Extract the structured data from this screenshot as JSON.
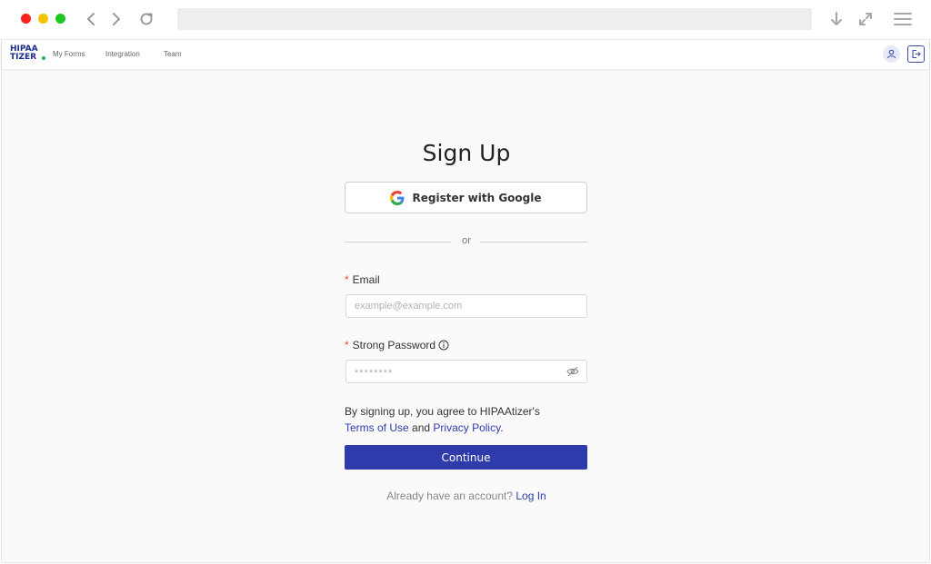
{
  "browser": {
    "controls": [
      "close",
      "minimize",
      "maximize"
    ],
    "icons": [
      "back-icon",
      "forward-icon",
      "reload-icon",
      "download-icon",
      "expand-icon",
      "menu-icon"
    ]
  },
  "app_header": {
    "logo_line1": "HIPAA",
    "logo_line2": "TIZER",
    "nav": [
      "My Forms",
      "Integration",
      "Team"
    ],
    "icons": [
      "user-icon",
      "logout-icon"
    ]
  },
  "form": {
    "title": "Sign Up",
    "google_label": "Register with Google",
    "divider_text": "or",
    "email_label": "Email",
    "email_placeholder": "example@example.com",
    "password_label": "Strong Password",
    "password_value": "********",
    "required_mark": "*",
    "terms_prefix": "By signing up, you agree to HIPAAtizer's",
    "terms_link": "Terms of Use",
    "terms_and": "and",
    "privacy_link": "Privacy Policy",
    "terms_suffix": ".",
    "continue_label": "Continue",
    "login_prompt": "Already have an account?",
    "login_link": "Log In"
  },
  "colors": {
    "primary": "#2f3baa",
    "link": "#2f3bb0",
    "required": "#e8512e",
    "logo_blue": "#1c2c8c",
    "logo_green": "#2fb34a"
  }
}
